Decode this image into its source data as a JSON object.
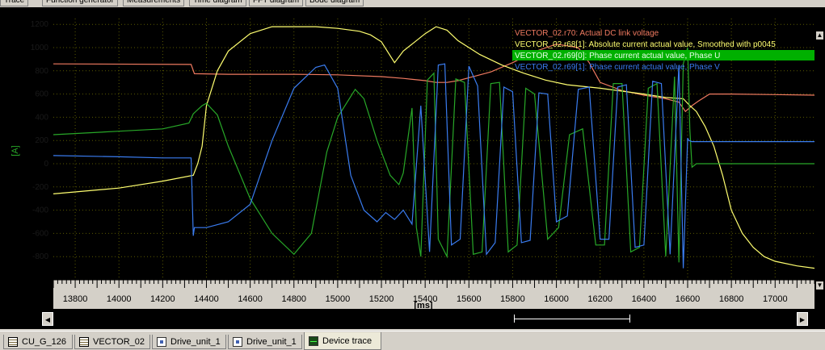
{
  "top_tabs": [
    "Trace",
    "Function generator",
    "Measurements",
    "Time diagram",
    "FFT diagram",
    "Bode diagram"
  ],
  "bottom_tabs": [
    {
      "label": "CU_G_126",
      "icon": "document-icon"
    },
    {
      "label": "VECTOR_02",
      "icon": "document-icon"
    },
    {
      "label": "Drive_unit_1",
      "icon": "device-icon"
    },
    {
      "label": "Drive_unit_1",
      "icon": "drive-icon"
    },
    {
      "label": "Device trace",
      "icon": "oscilloscope-icon"
    }
  ],
  "colors": {
    "plot_bg": "#000000",
    "grid": "#5a5a00",
    "axis": "#000000",
    "tick_label": "#1a1a1a",
    "red": "#f07a60",
    "yellow": "#ffff70",
    "green": "#28a828",
    "blue": "#3a7cf0",
    "legend_highlight": "#00b000"
  },
  "chart_data": {
    "type": "line",
    "xlabel": "[ms]",
    "ylabel": "[A]",
    "xlim": [
      13700,
      17180
    ],
    "ylim": [
      -1000,
      1250
    ],
    "x_ticks": [
      13800,
      14000,
      14200,
      14400,
      14600,
      14800,
      15000,
      15200,
      15400,
      15600,
      15800,
      16000,
      16200,
      16400,
      16600,
      16800,
      17000
    ],
    "y_ticks": [
      1200,
      1000,
      800,
      600,
      400,
      200,
      0,
      -200,
      -400,
      -600,
      -800
    ],
    "y_tick_labels": [
      "1200",
      "1000",
      "800",
      "600",
      "400",
      "200",
      "0",
      "-200",
      "-400",
      "-600",
      "-800"
    ],
    "grid": true,
    "legend_position": "top-right",
    "series": [
      {
        "name": "VECTOR_02.r70: Actual DC link voltage",
        "color": "#f07a60",
        "x": [
          13700,
          14330,
          14345,
          14500,
          14800,
          15000,
          15200,
          15300,
          15400,
          15450,
          15500,
          15550,
          15600,
          15700,
          15800,
          15900,
          16000,
          16100,
          16150,
          16200,
          16300,
          16400,
          16500,
          16560,
          16590,
          16620,
          16650,
          16700,
          16800,
          17000,
          17180
        ],
        "y": [
          860,
          855,
          775,
          770,
          770,
          765,
          750,
          735,
          715,
          700,
          700,
          715,
          740,
          790,
          870,
          965,
          1030,
          1000,
          870,
          700,
          630,
          590,
          560,
          530,
          450,
          500,
          540,
          600,
          600,
          595,
          590
        ]
      },
      {
        "name": "VECTOR_02.r68[1]: Absolute current actual value, Smoothed with p0045",
        "color": "#ffff70",
        "x": [
          13700,
          14000,
          14200,
          14340,
          14360,
          14380,
          14400,
          14450,
          14500,
          14600,
          14700,
          14900,
          15000,
          15100,
          15150,
          15200,
          15260,
          15300,
          15400,
          15450,
          15500,
          15550,
          15650,
          15750,
          15850,
          15950,
          16050,
          16200,
          16400,
          16500,
          16580,
          16610,
          16640,
          16680,
          16720,
          16760,
          16800,
          16850,
          16900,
          16950,
          17000,
          17100,
          17180
        ],
        "y": [
          -260,
          -210,
          -150,
          -100,
          0,
          150,
          500,
          800,
          970,
          1120,
          1180,
          1180,
          1165,
          1140,
          1110,
          1050,
          870,
          970,
          1120,
          1180,
          1150,
          1060,
          940,
          850,
          780,
          720,
          680,
          650,
          600,
          570,
          560,
          500,
          450,
          320,
          150,
          -100,
          -400,
          -600,
          -720,
          -800,
          -840,
          -880,
          -900
        ]
      },
      {
        "name": "VECTOR_02.r69[0]: Phase current actual value, Phase U",
        "color": "#28a828",
        "highlighted": true,
        "x": [
          13700,
          14000,
          14200,
          14320,
          14340,
          14380,
          14400,
          14450,
          14500,
          14600,
          14700,
          14800,
          14880,
          14950,
          15000,
          15080,
          15120,
          15180,
          15240,
          15280,
          15300,
          15320,
          15340,
          15360,
          15380,
          15410,
          15440,
          15460,
          15500,
          15540,
          15580,
          15620,
          15660,
          15700,
          15740,
          15780,
          15820,
          15860,
          15900,
          15960,
          16010,
          16060,
          16120,
          16180,
          16220,
          16260,
          16300,
          16340,
          16380,
          16420,
          16460,
          16500,
          16540,
          16560,
          16580,
          16600,
          16610,
          16620,
          16640,
          16700,
          17180
        ],
        "y": [
          250,
          280,
          300,
          350,
          430,
          500,
          520,
          420,
          150,
          -300,
          -600,
          -780,
          -600,
          100,
          400,
          640,
          560,
          200,
          -100,
          -180,
          -80,
          200,
          480,
          -550,
          -800,
          720,
          780,
          -650,
          -800,
          730,
          700,
          -780,
          -760,
          690,
          700,
          -760,
          -700,
          650,
          600,
          -650,
          -550,
          250,
          300,
          -700,
          -700,
          690,
          690,
          -760,
          -720,
          650,
          690,
          -800,
          750,
          -850,
          860,
          1000,
          300,
          -30,
          0,
          0,
          0
        ]
      },
      {
        "name": "VECTOR_02.r69[1]: Phase current actual value, Phase V",
        "color": "#3a7cf0",
        "x": [
          13700,
          14000,
          14200,
          14330,
          14340,
          14345,
          14400,
          14500,
          14600,
          14700,
          14800,
          14900,
          14940,
          15000,
          15060,
          15120,
          15180,
          15220,
          15260,
          15300,
          15340,
          15380,
          15420,
          15460,
          15490,
          15520,
          15560,
          15600,
          15640,
          15680,
          15720,
          15760,
          15800,
          15840,
          15880,
          15920,
          15960,
          16000,
          16050,
          16100,
          16150,
          16200,
          16240,
          16280,
          16320,
          16360,
          16400,
          16440,
          16480,
          16520,
          16560,
          16580,
          16600,
          16605,
          16620,
          16700,
          17180
        ],
        "y": [
          70,
          60,
          50,
          50,
          -620,
          -550,
          -550,
          -500,
          -350,
          200,
          650,
          830,
          850,
          650,
          -100,
          -400,
          -500,
          -420,
          -480,
          -400,
          -520,
          500,
          -760,
          850,
          860,
          -700,
          -650,
          840,
          670,
          -780,
          -680,
          660,
          620,
          -680,
          -660,
          610,
          600,
          -500,
          -450,
          640,
          660,
          -650,
          -650,
          660,
          680,
          -720,
          -700,
          710,
          690,
          -780,
          850,
          -900,
          220,
          200,
          190,
          190,
          190
        ]
      }
    ]
  }
}
